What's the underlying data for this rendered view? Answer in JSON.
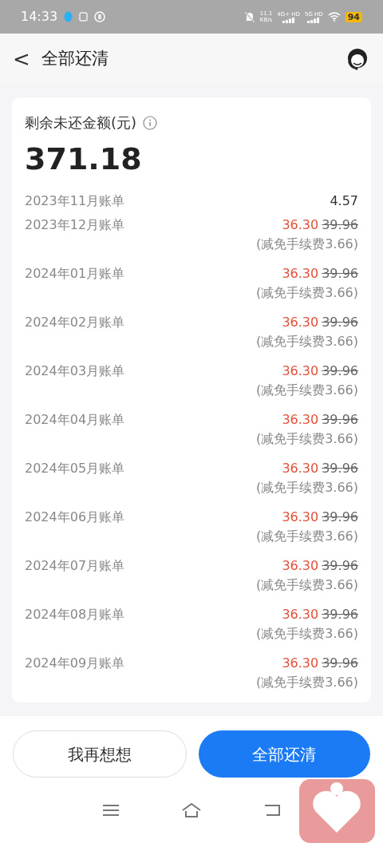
{
  "status_bar": {
    "time": "14:33",
    "net_speed": "11.1",
    "net_unit": "KB/s",
    "signal_1": "4G+ HD",
    "signal_2": "5G HD",
    "battery": "94"
  },
  "header": {
    "back": "<",
    "title": "全部还清"
  },
  "summary": {
    "label": "剩余未还金额(元)",
    "amount": "371.18"
  },
  "statements": [
    {
      "kind": "plain",
      "label": "2023年11月账单",
      "amount": "4.57"
    },
    {
      "kind": "discounted",
      "label": "2023年12月账单",
      "amount": "36.30",
      "original": "39.96",
      "note": "(减免手续费3.66)"
    },
    {
      "kind": "discounted",
      "label": "2024年01月账单",
      "amount": "36.30",
      "original": "39.96",
      "note": "(减免手续费3.66)"
    },
    {
      "kind": "discounted",
      "label": "2024年02月账单",
      "amount": "36.30",
      "original": "39.96",
      "note": "(减免手续费3.66)"
    },
    {
      "kind": "discounted",
      "label": "2024年03月账单",
      "amount": "36.30",
      "original": "39.96",
      "note": "(减免手续费3.66)"
    },
    {
      "kind": "discounted",
      "label": "2024年04月账单",
      "amount": "36.30",
      "original": "39.96",
      "note": "(减免手续费3.66)"
    },
    {
      "kind": "discounted",
      "label": "2024年05月账单",
      "amount": "36.30",
      "original": "39.96",
      "note": "(减免手续费3.66)"
    },
    {
      "kind": "discounted",
      "label": "2024年06月账单",
      "amount": "36.30",
      "original": "39.96",
      "note": "(减免手续费3.66)"
    },
    {
      "kind": "discounted",
      "label": "2024年07月账单",
      "amount": "36.30",
      "original": "39.96",
      "note": "(减免手续费3.66)"
    },
    {
      "kind": "discounted",
      "label": "2024年08月账单",
      "amount": "36.30",
      "original": "39.96",
      "note": "(减免手续费3.66)"
    },
    {
      "kind": "discounted",
      "label": "2024年09月账单",
      "amount": "36.30",
      "original": "39.96",
      "note": "(减免手续费3.66)"
    }
  ],
  "buttons": [
    {
      "kind": "secondary",
      "label": "我再想想"
    },
    {
      "kind": "primary",
      "label": "全部还清"
    }
  ]
}
